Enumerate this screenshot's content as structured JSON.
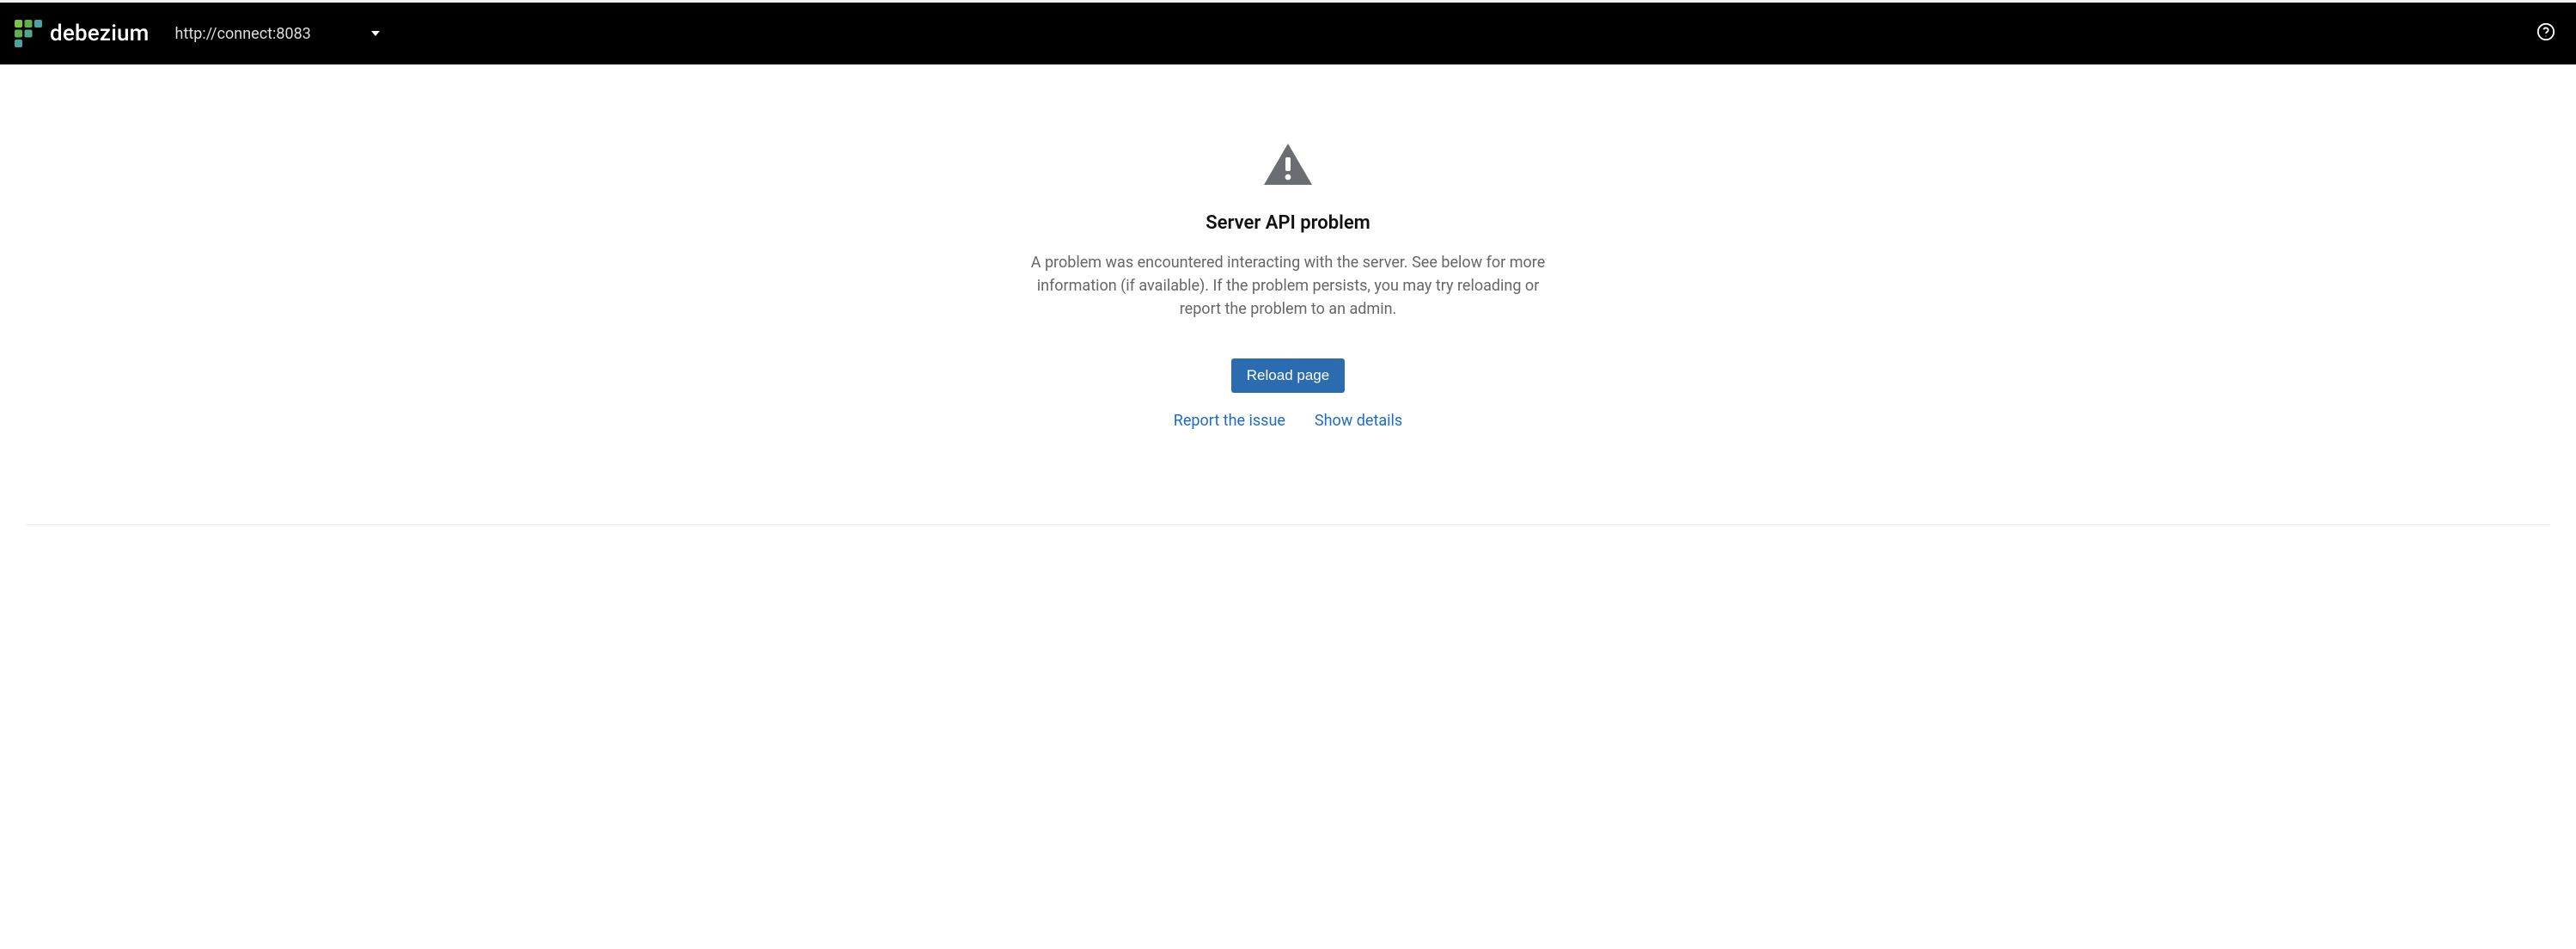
{
  "header": {
    "brand": "debezium",
    "cluster_url": "http://connect:8083"
  },
  "error": {
    "title": "Server API problem",
    "description": "A problem was encountered interacting with the server. See below for more information (if available). If the problem persists, you may try reloading or report the problem to an admin.",
    "reload_label": "Reload page",
    "report_label": "Report the issue",
    "details_label": "Show details"
  }
}
